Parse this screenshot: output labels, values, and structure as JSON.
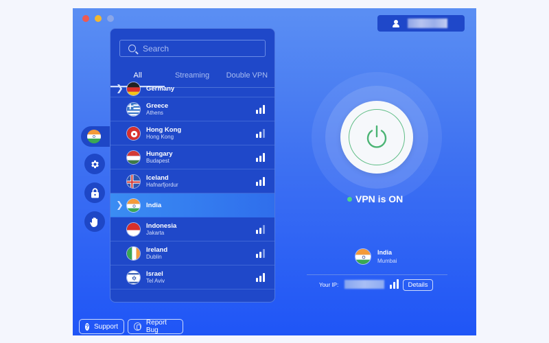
{
  "window": {
    "traffic_lights": [
      "close",
      "minimize",
      "zoom"
    ]
  },
  "account": {
    "icon": "user-icon",
    "name_redacted": true
  },
  "sidebar": {
    "items": [
      {
        "name": "location",
        "icon": "india-flag-icon",
        "active": true
      },
      {
        "name": "settings",
        "icon": "gear-icon",
        "active": false
      },
      {
        "name": "security",
        "icon": "lock-icon",
        "active": false
      },
      {
        "name": "blocker",
        "icon": "hand-icon",
        "active": false
      }
    ]
  },
  "server_panel": {
    "search_placeholder": "Search",
    "tabs": [
      {
        "label": "All",
        "active": true
      },
      {
        "label": "Streaming",
        "active": false
      },
      {
        "label": "Double VPN",
        "active": false
      }
    ],
    "servers": [
      {
        "country": "Germany",
        "city": "",
        "expandable": true,
        "signal": null,
        "flag": "germany"
      },
      {
        "country": "Greece",
        "city": "Athens",
        "expandable": false,
        "signal": 3,
        "flag": "greece"
      },
      {
        "country": "Hong Kong",
        "city": "Hong Kong",
        "expandable": false,
        "signal": 2,
        "flag": "hongkong"
      },
      {
        "country": "Hungary",
        "city": "Budapest",
        "expandable": false,
        "signal": 3,
        "flag": "hungary"
      },
      {
        "country": "Iceland",
        "city": "Hafnarfjordur",
        "expandable": false,
        "signal": 3,
        "flag": "iceland"
      },
      {
        "country": "India",
        "city": "",
        "expandable": true,
        "selected": true,
        "signal": null,
        "flag": "india"
      },
      {
        "country": "Indonesia",
        "city": "Jakarta",
        "expandable": false,
        "signal": 2,
        "flag": "indonesia"
      },
      {
        "country": "Ireland",
        "city": "Dublin",
        "expandable": false,
        "signal": 2,
        "flag": "ireland"
      },
      {
        "country": "Israel",
        "city": "Tel Aviv",
        "expandable": false,
        "signal": 3,
        "flag": "israel"
      }
    ]
  },
  "vpn": {
    "status_text": "VPN is ON",
    "status_color": "#4ed48a",
    "power_icon": "power-icon"
  },
  "connection": {
    "country": "India",
    "city": "Mumbai",
    "ip_label": "Your IP:",
    "ip_redacted": true,
    "signal": 3,
    "details_label": "Details"
  },
  "footer": {
    "support_label": "Support",
    "report_label": "Report Bug"
  }
}
